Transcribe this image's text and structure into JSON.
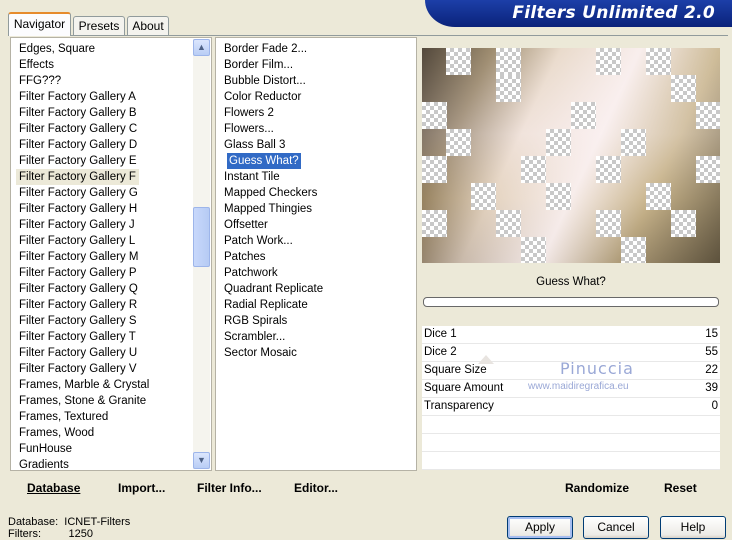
{
  "tabs": [
    "Navigator",
    "Presets",
    "About"
  ],
  "title": "Filters Unlimited 2.0",
  "categories": [
    "Edges, Square",
    "Effects",
    "FFG???",
    "Filter Factory Gallery A",
    "Filter Factory Gallery B",
    "Filter Factory Gallery C",
    "Filter Factory Gallery D",
    "Filter Factory Gallery E",
    "Filter Factory Gallery F",
    "Filter Factory Gallery G",
    "Filter Factory Gallery H",
    "Filter Factory Gallery J",
    "Filter Factory Gallery L",
    "Filter Factory Gallery M",
    "Filter Factory Gallery P",
    "Filter Factory Gallery Q",
    "Filter Factory Gallery R",
    "Filter Factory Gallery S",
    "Filter Factory Gallery T",
    "Filter Factory Gallery U",
    "Filter Factory Gallery V",
    "Frames, Marble & Crystal",
    "Frames, Stone & Granite",
    "Frames, Textured",
    "Frames, Wood",
    "FunHouse",
    "Gradients"
  ],
  "filters": [
    "Border Fade 2...",
    "Border Film...",
    "Bubble Distort...",
    "Color Reductor",
    "Flowers 2",
    "Flowers...",
    "Glass Ball 3",
    "Guess What?",
    "Instant Tile",
    "Mapped Checkers",
    "Mapped Thingies",
    "Offsetter",
    "Patch Work...",
    "Patches",
    "Patchwork",
    "Quadrant Replicate",
    "Radial Replicate",
    "RGB Spirals",
    "Scrambler...",
    "Sector Mosaic"
  ],
  "selected_category": "Filter Factory Gallery F",
  "selected_filter": "Guess What?",
  "preview_label": "Guess What?",
  "params": [
    {
      "label": "Dice 1",
      "value": "15"
    },
    {
      "label": "Dice 2",
      "value": "55"
    },
    {
      "label": "Square Size",
      "value": "22"
    },
    {
      "label": "Square Amount",
      "value": "39"
    },
    {
      "label": "Transparency",
      "value": "0"
    }
  ],
  "watermark": {
    "name": "Pinuccia",
    "url": "www.maidiregrafica.eu"
  },
  "left_buttons": {
    "database": "Database",
    "import": "Import...",
    "filter_info": "Filter Info...",
    "editor": "Editor..."
  },
  "right_buttons": {
    "randomize": "Randomize",
    "reset": "Reset"
  },
  "status": {
    "database_label": "Database:",
    "database_value": "ICNET-Filters",
    "filters_label": "Filters:",
    "filters_value": "1250"
  },
  "dialog_buttons": {
    "apply": "Apply",
    "cancel": "Cancel",
    "help": "Help"
  },
  "icons": {
    "scroll_up": "chevron-up-icon",
    "scroll_down": "chevron-down-icon"
  }
}
